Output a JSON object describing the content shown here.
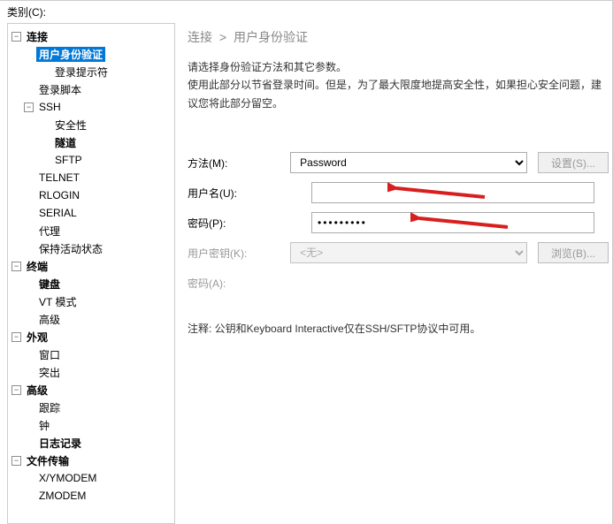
{
  "header": {
    "category_label": "类别(C):"
  },
  "tree": {
    "nodes": [
      {
        "id": "conn",
        "label": "连接",
        "bold": true,
        "depth": 0,
        "expandable": true,
        "expanded": true
      },
      {
        "id": "auth",
        "label": "用户身份验证",
        "bold": true,
        "depth": 1,
        "selected": true
      },
      {
        "id": "loginprompt",
        "label": "登录提示符",
        "bold": false,
        "depth": 2
      },
      {
        "id": "loginscript",
        "label": "登录脚本",
        "bold": false,
        "depth": 1
      },
      {
        "id": "ssh",
        "label": "SSH",
        "bold": false,
        "depth": 1,
        "expandable": true,
        "expanded": true
      },
      {
        "id": "security",
        "label": "安全性",
        "bold": false,
        "depth": 2
      },
      {
        "id": "tunnel",
        "label": "隧道",
        "bold": true,
        "depth": 2
      },
      {
        "id": "sftp",
        "label": "SFTP",
        "bold": false,
        "depth": 2
      },
      {
        "id": "telnet",
        "label": "TELNET",
        "bold": false,
        "depth": 1
      },
      {
        "id": "rlogin",
        "label": "RLOGIN",
        "bold": false,
        "depth": 1
      },
      {
        "id": "serial",
        "label": "SERIAL",
        "bold": false,
        "depth": 1
      },
      {
        "id": "proxy",
        "label": "代理",
        "bold": false,
        "depth": 1
      },
      {
        "id": "keepalive",
        "label": "保持活动状态",
        "bold": false,
        "depth": 1
      },
      {
        "id": "terminal",
        "label": "终端",
        "bold": true,
        "depth": 0,
        "expandable": true,
        "expanded": true
      },
      {
        "id": "keyboard",
        "label": "键盘",
        "bold": true,
        "depth": 1
      },
      {
        "id": "vtmode",
        "label": "VT 模式",
        "bold": false,
        "depth": 1
      },
      {
        "id": "adv1",
        "label": "高级",
        "bold": false,
        "depth": 1
      },
      {
        "id": "appearance",
        "label": "外观",
        "bold": true,
        "depth": 0,
        "expandable": true,
        "expanded": true
      },
      {
        "id": "window",
        "label": "窗口",
        "bold": false,
        "depth": 1
      },
      {
        "id": "highlight",
        "label": "突出",
        "bold": false,
        "depth": 1
      },
      {
        "id": "advanced",
        "label": "高级",
        "bold": true,
        "depth": 0,
        "expandable": true,
        "expanded": true
      },
      {
        "id": "trace",
        "label": "跟踪",
        "bold": false,
        "depth": 1
      },
      {
        "id": "bell",
        "label": "钟",
        "bold": false,
        "depth": 1
      },
      {
        "id": "logging",
        "label": "日志记录",
        "bold": true,
        "depth": 1
      },
      {
        "id": "filetrans",
        "label": "文件传输",
        "bold": true,
        "depth": 0,
        "expandable": true,
        "expanded": true
      },
      {
        "id": "xymodem",
        "label": "X/YMODEM",
        "bold": false,
        "depth": 1
      },
      {
        "id": "zmodem",
        "label": "ZMODEM",
        "bold": false,
        "depth": 1
      }
    ]
  },
  "breadcrumb": {
    "parent": "连接",
    "sep": ">",
    "current": "用户身份验证"
  },
  "instructions": {
    "line1": "请选择身份验证方法和其它参数。",
    "line2": "使用此部分以节省登录时间。但是，为了最大限度地提高安全性，如果担心安全问题，建议您将此部分留空。"
  },
  "form": {
    "method_label": "方法(M):",
    "method_value": "Password",
    "settings_btn": "设置(S)...",
    "username_label": "用户名(U):",
    "username_value": "",
    "password_label": "密码(P):",
    "password_value": "•••••••••",
    "userkey_label": "用户密钥(K):",
    "userkey_value": "<无>",
    "browse_btn": "浏览(B)...",
    "passphrase_label": "密码(A):"
  },
  "note": "注释: 公钥和Keyboard Interactive仅在SSH/SFTP协议中可用。"
}
